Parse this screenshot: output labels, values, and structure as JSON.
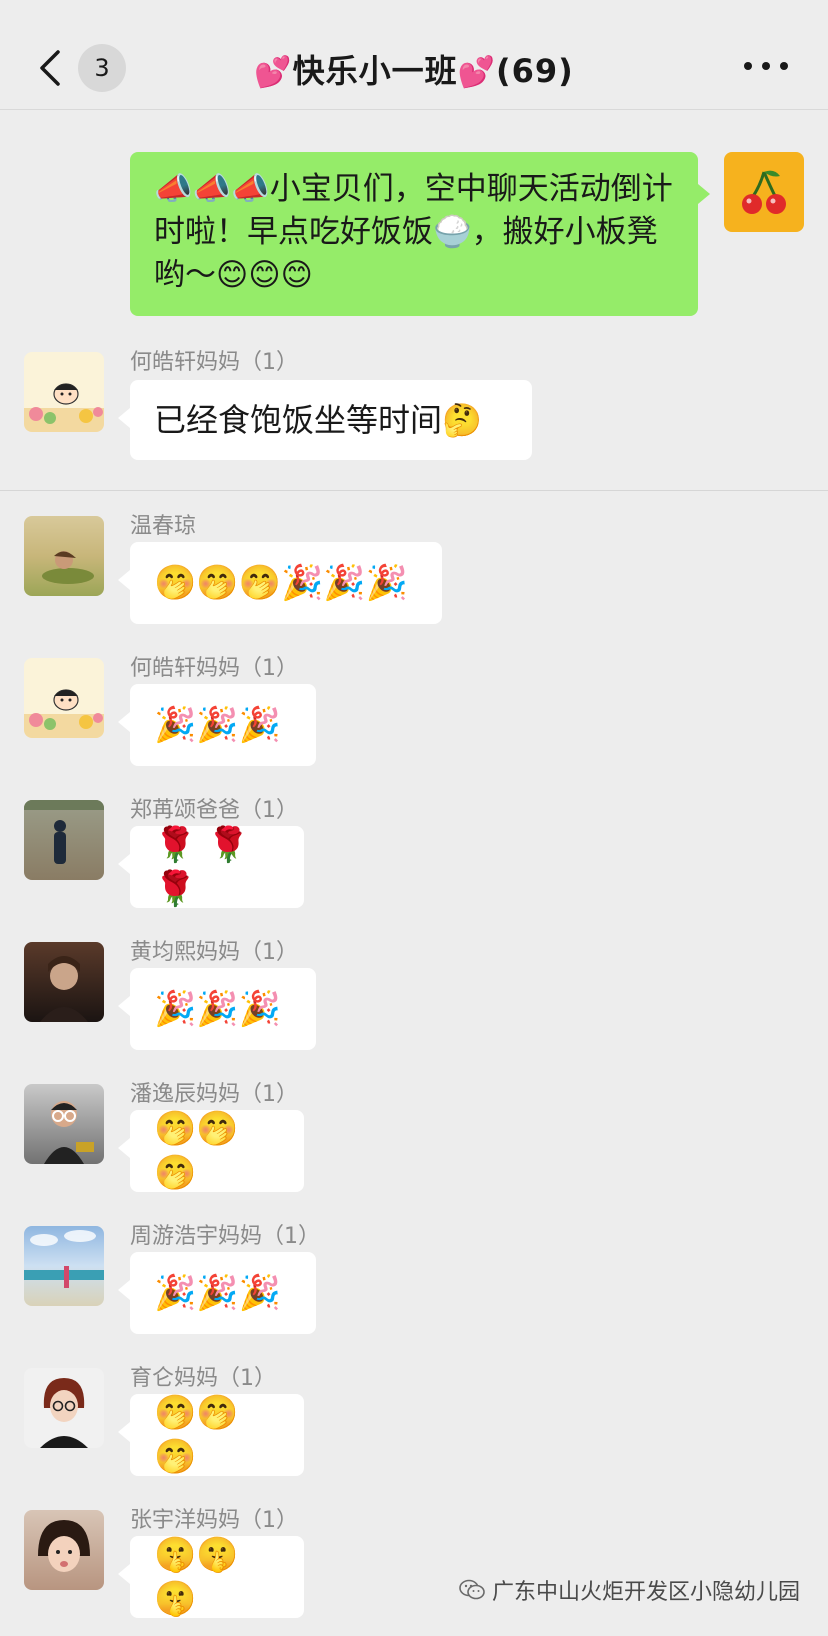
{
  "header": {
    "back_count": "3",
    "title_text": "快乐小一班",
    "member_count": "(69)"
  },
  "messages": [
    {
      "self": true,
      "text": "📣📣📣小宝贝们，空中聊天活动倒计时啦！早点吃好饭饭🍚，搬好小板凳哟～😊😊😊"
    },
    {
      "sender": "何皓轩妈妈（1）",
      "text": "已经食饱饭坐等时间🤔"
    },
    {
      "sender": "温春琼",
      "text": "🤭🤭🤭🎉🎉🎉"
    },
    {
      "sender": "何皓轩妈妈（1）",
      "text": "🎉🎉🎉"
    },
    {
      "sender": "郑苒颂爸爸（1）",
      "text": "🌹 🌹 🌹"
    },
    {
      "sender": "黄均熙妈妈（1）",
      "text": "🎉🎉🎉"
    },
    {
      "sender": "潘逸辰妈妈（1）",
      "text": "🤭🤭🤭"
    },
    {
      "sender": "周游浩宇妈妈（1）",
      "text": "🎉🎉🎉"
    },
    {
      "sender": "育仑妈妈（1）",
      "text": "🤭🤭🤭"
    },
    {
      "sender": "张宇洋妈妈（1）",
      "text": "🤫🤫🤫"
    }
  ],
  "watermark": "广东中山火炬开发区小隐幼儿园",
  "colors": {
    "self_bubble": "#95ec69",
    "background": "#ededed"
  }
}
